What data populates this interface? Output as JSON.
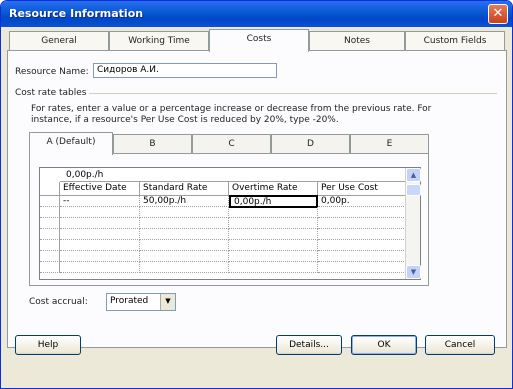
{
  "window": {
    "title": "Resource Information"
  },
  "tabs": [
    "General",
    "Working Time",
    "Costs",
    "Notes",
    "Custom Fields"
  ],
  "resource_name": {
    "label": "Resource Name:",
    "value": "Сидоров А.И."
  },
  "cost_rate_tables": {
    "label": "Cost rate tables",
    "hint_line1": "For rates, enter a value or a percentage increase or decrease from the previous rate. For",
    "hint_line2": "instance, if a resource's Per Use Cost is reduced by 20%, type -20%.",
    "tabs": [
      "A (Default)",
      "B",
      "C",
      "D",
      "E"
    ]
  },
  "grid": {
    "edit_value": "0,00р./h",
    "columns": [
      "Effective Date",
      "Standard Rate",
      "Overtime Rate",
      "Per Use Cost"
    ],
    "rows": [
      [
        "--",
        "50,00р./h",
        "0,00р./h",
        "0,00р."
      ]
    ]
  },
  "cost_accrual": {
    "label": "Cost accrual:",
    "value": "Prorated"
  },
  "buttons": {
    "help": "Help",
    "details": "Details...",
    "ok": "OK",
    "cancel": "Cancel"
  }
}
